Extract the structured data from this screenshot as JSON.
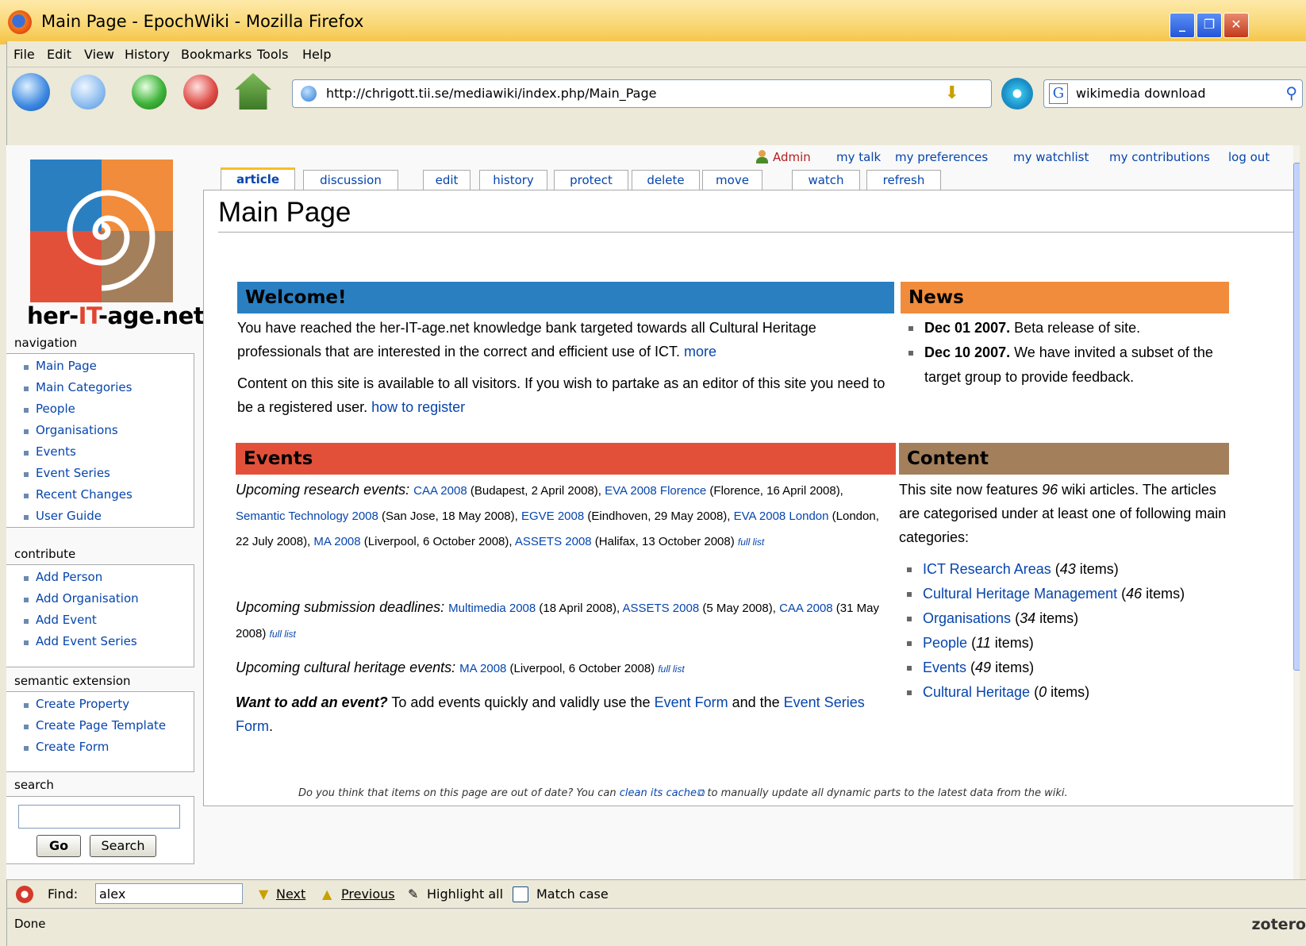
{
  "window": {
    "title": "Main Page - EpochWiki - Mozilla Firefox"
  },
  "menu": [
    "File",
    "Edit",
    "View",
    "History",
    "Bookmarks",
    "Tools",
    "Help"
  ],
  "address": {
    "url": "http://chrigott.tii.se/mediawiki/index.php/Main_Page"
  },
  "websearch": {
    "value": "wikimedia download"
  },
  "site": {
    "name_pre": "her-",
    "name_it": "IT",
    "name_post": "-age.net"
  },
  "sidebar": {
    "navigation": {
      "heading": "navigation",
      "items": [
        "Main Page",
        "Main Categories",
        "People",
        "Organisations",
        "Events",
        "Event Series",
        "Recent Changes",
        "User Guide"
      ]
    },
    "contribute": {
      "heading": "contribute",
      "items": [
        "Add Person",
        "Add Organisation",
        "Add Event",
        "Add Event Series"
      ]
    },
    "semantic": {
      "heading": "semantic extension",
      "items": [
        "Create Property",
        "Create Page Template",
        "Create Form"
      ]
    },
    "search": {
      "heading": "search",
      "go": "Go",
      "search": "Search"
    }
  },
  "personal": [
    "Admin",
    "my talk",
    "my preferences",
    "my watchlist",
    "my contributions",
    "log out"
  ],
  "tabs": [
    "article",
    "discussion",
    "edit",
    "history",
    "protect",
    "delete",
    "move",
    "watch",
    "refresh"
  ],
  "page": {
    "title": "Main Page"
  },
  "welcome": {
    "heading": "Welcome!",
    "p1": "You have reached the her-IT-age.net knowledge bank targeted towards all Cultural Heritage professionals that are interested in the correct and efficient use of ICT.",
    "p1_link": "more",
    "p2": "Content on this site is available to all visitors. If you wish to partake as an editor of this site you need to be a registered user.",
    "p2_link": "how to register"
  },
  "events": {
    "heading": "Events",
    "research_label": "Upcoming research events:",
    "research": [
      {
        "link": "CAA 2008",
        "text": " (Budapest, 2 April 2008), "
      },
      {
        "link": "EVA 2008 Florence",
        "text": " (Florence, 16 April 2008), "
      },
      {
        "link": "Semantic Technology 2008",
        "text": " (San Jose, 18 May 2008), "
      },
      {
        "link": "EGVE 2008",
        "text": " (Eindhoven, 29 May 2008), "
      },
      {
        "link": "EVA 2008 London",
        "text": " (London, 22 July 2008), "
      },
      {
        "link": "MA 2008",
        "text": " (Liverpool, 6 October 2008), "
      },
      {
        "link": "ASSETS 2008",
        "text": " (Halifax, 13 October 2008) "
      }
    ],
    "full_list": "full list",
    "submission_label": "Upcoming submission deadlines:",
    "submission": [
      {
        "link": "Multimedia 2008",
        "text": " (18 April 2008), "
      },
      {
        "link": "ASSETS 2008",
        "text": " (5 May 2008), "
      },
      {
        "link": "CAA 2008",
        "text": " (31 May 2008) "
      }
    ],
    "heritage_label": "Upcoming cultural heritage events:",
    "heritage": [
      {
        "link": "MA 2008",
        "text": " (Liverpool, 6 October 2008) "
      }
    ],
    "add_bold": "Want to add an event?",
    "add_text1": " To add events quickly and validly use the ",
    "add_link1": "Event Form",
    "add_text2": " and the ",
    "add_link2": "Event Series Form",
    "add_text3": "."
  },
  "news": {
    "heading": "News",
    "items": [
      {
        "date": "Dec 01 2007.",
        "text": " Beta release of site."
      },
      {
        "date": "Dec 10 2007.",
        "text": " We have invited a subset of the target group to provide feedback."
      }
    ]
  },
  "content": {
    "heading": "Content",
    "intro_a": "This site now features ",
    "count": "96",
    "intro_b": " wiki articles. The articles are categorised under at least one of following main categories:",
    "items": [
      {
        "name": "ICT Research Areas",
        "n": "43"
      },
      {
        "name": "Cultural Heritage Management",
        "n": "46"
      },
      {
        "name": "Organisations",
        "n": "34"
      },
      {
        "name": "People",
        "n": "11"
      },
      {
        "name": "Events",
        "n": "49"
      },
      {
        "name": "Cultural Heritage",
        "n": "0"
      }
    ],
    "items_word": " items)"
  },
  "footnote": {
    "a": "Do you think that items on this page are out of date? You can ",
    "link": "clean its cache",
    "b": " to manually update all dynamic parts to the latest data from the wiki."
  },
  "findbar": {
    "label": "Find:",
    "value": "alex",
    "next": "Next",
    "previous": "Previous",
    "highlight": "Highlight all",
    "match": "Match case"
  },
  "status": {
    "text": "Done",
    "addon": "zotero"
  },
  "colors": {
    "welcome": "#2a7fc1",
    "news": "#f08c3c",
    "events": "#e3503a",
    "content": "#a47f5b",
    "link": "#0645ad"
  }
}
